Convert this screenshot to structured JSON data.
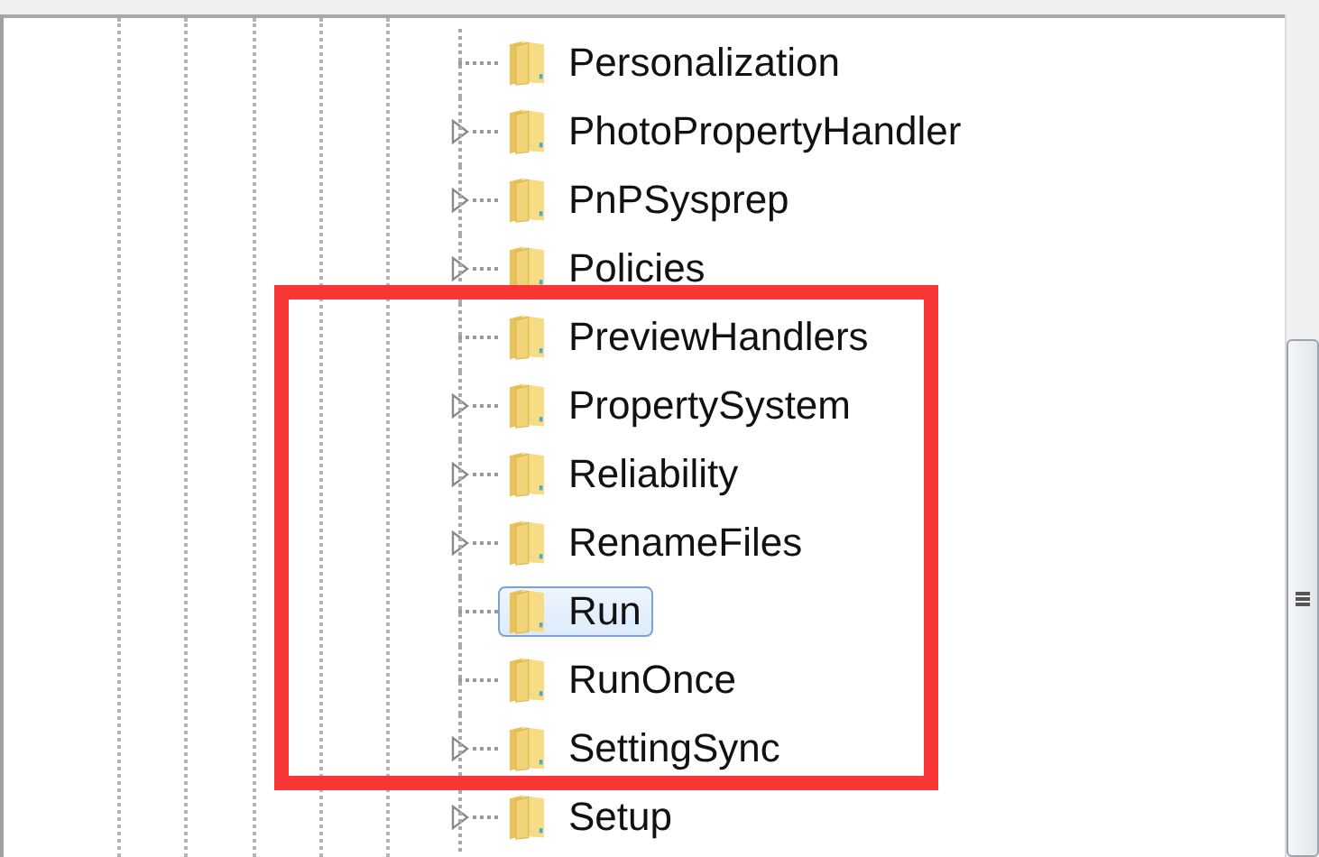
{
  "tree": {
    "items": [
      {
        "label": "Personalization",
        "expandable": false,
        "selected": false
      },
      {
        "label": "PhotoPropertyHandler",
        "expandable": true,
        "selected": false
      },
      {
        "label": "PnPSysprep",
        "expandable": true,
        "selected": false
      },
      {
        "label": "Policies",
        "expandable": true,
        "selected": false
      },
      {
        "label": "PreviewHandlers",
        "expandable": false,
        "selected": false
      },
      {
        "label": "PropertySystem",
        "expandable": true,
        "selected": false
      },
      {
        "label": "Reliability",
        "expandable": true,
        "selected": false
      },
      {
        "label": "RenameFiles",
        "expandable": true,
        "selected": false
      },
      {
        "label": "Run",
        "expandable": false,
        "selected": true
      },
      {
        "label": "RunOnce",
        "expandable": false,
        "selected": false
      },
      {
        "label": "SettingSync",
        "expandable": true,
        "selected": false
      },
      {
        "label": "Setup",
        "expandable": true,
        "selected": false
      }
    ]
  },
  "annotation": {
    "highlight_frame": true
  }
}
